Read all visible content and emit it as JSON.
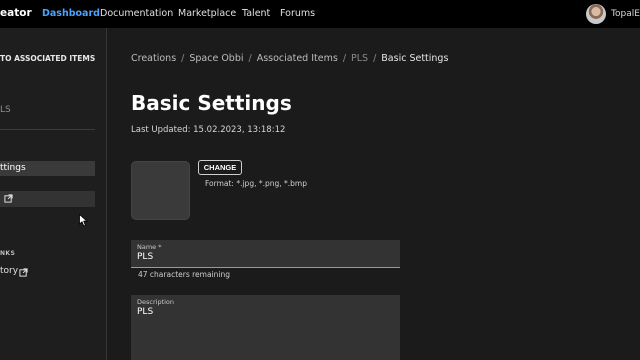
{
  "topbar": {
    "brand": "eator",
    "nav": [
      "Dashboard",
      "Documentation",
      "Marketplace",
      "Talent",
      "Forums"
    ],
    "active_nav": "Dashboard",
    "username": "TopalE"
  },
  "sidebar": {
    "back_label": "TO ASSOCIATED ITEMS",
    "item_name": "LS",
    "active_item": "ttings",
    "section_title": "NKS",
    "history_label": "tory"
  },
  "breadcrumb": [
    "Creations",
    "Space Obbi",
    "Associated Items",
    "PLS",
    "Basic Settings"
  ],
  "page": {
    "title": "Basic Settings",
    "last_updated": "Last Updated: 15.02.2023, 13:18:12"
  },
  "image": {
    "change_label": "CHANGE",
    "format_text": "Format: *.jpg, *.png, *.bmp"
  },
  "name_field": {
    "label": "Name *",
    "value": "PLS",
    "helper": "47 characters remaining"
  },
  "description_field": {
    "label": "Description",
    "value": "PLS"
  },
  "colors": {
    "accent": "#4aa3ff",
    "background": "#1b1b1c",
    "topbar": "#000000"
  },
  "icons": {
    "external_link": "external-link-icon",
    "cursor": "mouse-pointer-icon"
  }
}
